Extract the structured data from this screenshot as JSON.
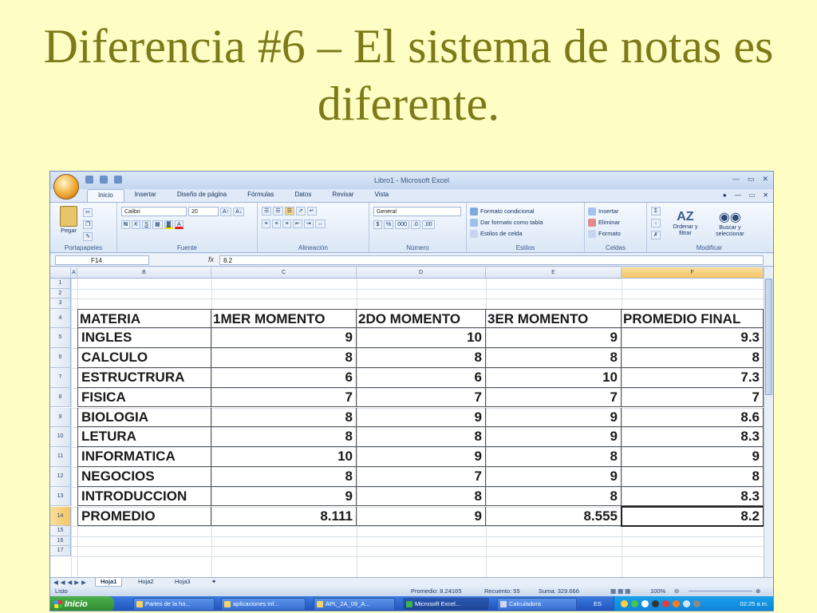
{
  "slide": {
    "title": "Diferencia #6 – El sistema de notas es diferente."
  },
  "window": {
    "title": "Libro1 - Microsoft Excel"
  },
  "tabs": [
    "Inicio",
    "Insertar",
    "Diseño de página",
    "Fórmulas",
    "Datos",
    "Revisar",
    "Vista"
  ],
  "ribbon": {
    "groups": [
      "Portapapeles",
      "Fuente",
      "Alineación",
      "Número",
      "Estilos",
      "Celdas",
      "Modificar"
    ],
    "paste_label": "Pegar",
    "font_name": "Calibri",
    "font_size": "20",
    "number_format": "General",
    "styles": [
      "Formato condicional",
      "Dar formato como tabla",
      "Estilos de celda"
    ],
    "cells": [
      "Insertar",
      "Eliminar",
      "Formato"
    ],
    "modify": [
      "Ordenar y filtrar",
      "Buscar y seleccionar"
    ]
  },
  "formula_bar": {
    "name_box": "F14",
    "fx": "fx",
    "value": "8.2"
  },
  "columns": [
    "A",
    "B",
    "C",
    "D",
    "E",
    "F"
  ],
  "rows": [
    "1",
    "2",
    "3",
    "4",
    "5",
    "6",
    "7",
    "8",
    "9",
    "10",
    "11",
    "12",
    "13",
    "14",
    "15",
    "16",
    "17"
  ],
  "table": {
    "header": [
      "MATERIA",
      "1MER MOMENTO",
      "2DO MOMENTO",
      "3ER MOMENTO",
      "PROMEDIO FINAL"
    ],
    "rows": [
      [
        "INGLES",
        "9",
        "10",
        "9",
        "9.3"
      ],
      [
        "CALCULO",
        "8",
        "8",
        "8",
        "8"
      ],
      [
        "ESTRUCTRURA",
        "6",
        "6",
        "10",
        "7.3"
      ],
      [
        "FISICA",
        "7",
        "7",
        "7",
        "7"
      ],
      [
        "BIOLOGIA",
        "8",
        "9",
        "9",
        "8.6"
      ],
      [
        "LETURA",
        "8",
        "8",
        "9",
        "8.3"
      ],
      [
        "INFORMATICA",
        "10",
        "9",
        "8",
        "9"
      ],
      [
        "NEGOCIOS",
        "8",
        "7",
        "9",
        "8"
      ],
      [
        "INTRODUCCION",
        "9",
        "8",
        "8",
        "8.3"
      ],
      [
        "PROMEDIO",
        "8.111",
        "9",
        "8.555",
        "8.2"
      ]
    ]
  },
  "sheets": [
    "Hoja1",
    "Hoja2",
    "Hoja3"
  ],
  "status": {
    "mode": "Listo",
    "average": "Promedio: 8.24165",
    "count": "Recuento: 55",
    "sum": "Suma: 329.666",
    "zoom": "100%"
  },
  "taskbar": {
    "start": "Inicio",
    "tasks": [
      "Partes de la ho...",
      "aplicaciones inf...",
      "APL_2A_09_A...",
      "Microsoft Excel...",
      "Calculadora"
    ],
    "lang": "ES",
    "time": "02:25 a.m."
  }
}
